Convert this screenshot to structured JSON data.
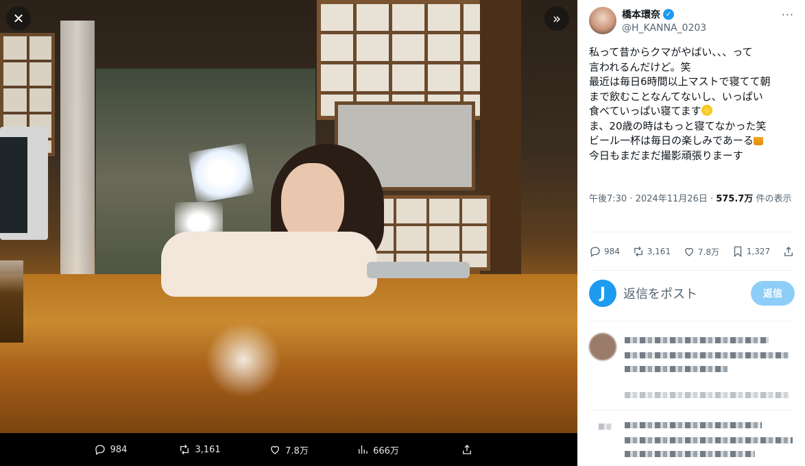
{
  "viewer": {
    "close_icon": "close-icon",
    "expand_icon": "chevrons-right-icon",
    "actions": [
      {
        "icon": "reply-icon",
        "count": "984"
      },
      {
        "icon": "retweet-icon",
        "count": "3,161"
      },
      {
        "icon": "like-icon",
        "count": "7.8万"
      },
      {
        "icon": "views-icon",
        "count": "666万"
      },
      {
        "icon": "share-icon",
        "count": ""
      }
    ]
  },
  "tweet": {
    "author_name": "橋本環奈",
    "author_handle": "@H_KANNA_0203",
    "verified": true,
    "lines": [
      "私って昔からクマがやばい、、、って",
      "言われるんだけど。笑",
      "最近は毎日6時間以上マストで寝てて朝",
      "まで飲むことなんてないし、いっぱい",
      "食べていっぱい寝てます",
      "ま、20歳の時はもっと寝てなかった笑",
      "ビール一杯は毎日の楽しみであーる",
      "今日もまだまだ撮影頑張りまーす"
    ],
    "emoji_line4": "smiling-face-emoji",
    "emoji_line6": "beer-mug-emoji",
    "time": "午後7:30",
    "date": "2024年11月26日",
    "views_count": "575.7万",
    "views_label": "件の表示",
    "stats": {
      "replies": "984",
      "retweets": "3,161",
      "likes": "7.8万",
      "bookmarks": "1,327"
    }
  },
  "reply_box": {
    "placeholder": "返信をポスト",
    "button_label": "返信",
    "avatar_letter": "J"
  },
  "colors": {
    "accent": "#1d9bf0",
    "reply_button_disabled": "#8ecdf8",
    "text_primary": "#0f1419",
    "text_secondary": "#536471"
  }
}
